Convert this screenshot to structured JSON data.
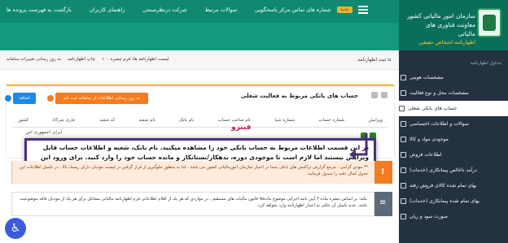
{
  "topbar": {
    "links": [
      "بازگشت به فهرست پرونده ها",
      "راهنمای کاربران",
      "شرکت درنظرسنجی",
      "سوالات مرتبط",
      "شماره های تماس مرکز پاسخگویی"
    ],
    "badge_new": "جدید"
  },
  "logo": {
    "line1": "سازمان امور مالیاتی کشور",
    "line2": "معاونت فناوری های مالیاتی",
    "line3": "اظهارنامه اشخاص حقیقی"
  },
  "sidebar": {
    "heading": "جداول اظهارنامه",
    "items": [
      {
        "label": "مشخصات هویتی",
        "active": false
      },
      {
        "label": "مشخصات محل و نوع فعالیت",
        "active": false
      },
      {
        "label": "حساب های بانکی شغلی",
        "active": true
      },
      {
        "label": "سوالات و اطلاعات اختصاصی",
        "active": false
      },
      {
        "label": "موجودی مواد و کالا",
        "active": false
      },
      {
        "label": "اطلاعات فروش",
        "active": false
      },
      {
        "label": "درآمد ناخالص پیمانکاری (خدمات)",
        "active": false
      },
      {
        "label": "بهای تمام شده کالای فروش رفته",
        "active": false
      },
      {
        "label": "بهای تمام شده پیمانکاری (خدمات)",
        "active": false
      },
      {
        "label": "صورت سود و زیان",
        "active": false
      }
    ]
  },
  "breadcrumb": {
    "label": "ثبت اظهارنامه",
    "links": [
      "به روز رسانی تغییرات سامانه",
      "چاپ اظهارنامه",
      "لیست اظهارنامه ها، فرم تبصره ۱۰۰"
    ]
  },
  "panel": {
    "title": "حساب های بانکی مربوط به فعالیت شغلی",
    "add_button": "اضافه",
    "fetch_button": "به روز رسانی اطلاعات از سامانه ثبت نام",
    "columns": [
      "ویرایش",
      "شماره حساب",
      "شماره شبا",
      "نام صاحب حساب",
      "نام بانک",
      "نام شعبه",
      "کد شعبه",
      "جاری شرکاء",
      "کشور"
    ],
    "row_country": "ایران (جمهوری اس"
  },
  "watermark": "فینزو",
  "callout": "در این قسمت اطلاعات مربوط به حساب بانکی خود را مشاهده میکنید. نام بانک، شعبه و اطلاعات حساب قابل ویرایش نیستند اما لازم است تا موجودی دوره، بدهکار/بستانکار و مانده حساب خود را وارد کنید. برای ورود این اطلاعات بر روی گزینه \" ویرایش\" کلیک کنید.",
  "alert": "** مودی گرامی ، مرجع گزارش تراکنش های بانکی شما در اختیار سازمان امورمالیاتی کشور می باشد ، لذا به منظور جلوگیری از قرار گرفتن در لیست مودیان دارای ریسک بالا ، در تکمیل اطلاعات این جدول کمال دقت را مبذول فرمایید.",
  "note": "نکته: بر اساس تبصره ماده ۳ آیین نامه اجرایی موضوع ماده۹۵ قانون مالیات های مستقیم ، در مواردی که هر یک از اقلام اطلاعاتی فرم اظهارنامه مالیاتی مشاغل برای هر یک از مودیان فاقد موضوعیت باشد، عدم تکمیل آن خللی به اعتبار اظهارنامه وارد نخواهد کرد.",
  "colors": {
    "topbar": "#0f8a71",
    "sidebar": "#243141",
    "accent_orange": "#f47b20",
    "accent_blue": "#1e88e5",
    "callout_border": "#4b2f7d"
  },
  "icons": [
    "home-icon",
    "phone-icon",
    "question-icon",
    "chart-icon",
    "book-icon",
    "arrow-icon",
    "print-icon",
    "refresh-icon",
    "accessibility-icon"
  ]
}
